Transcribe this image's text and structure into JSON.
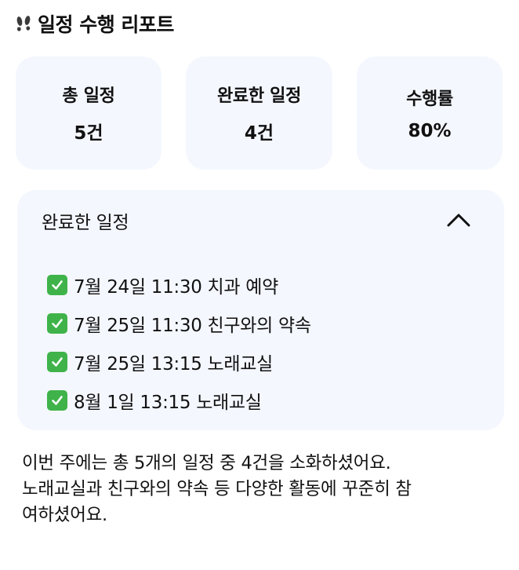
{
  "header": {
    "icon": "footprints-icon",
    "title": "일정 수행 리포트"
  },
  "stats": [
    {
      "label": "총 일정",
      "value": "5건"
    },
    {
      "label": "완료한 일정",
      "value": "4건"
    },
    {
      "label": "수행률",
      "value": "80%"
    }
  ],
  "completed": {
    "title": "완료한 일정",
    "expanded": true,
    "items": [
      {
        "text": "7월 24일 11:30 치과 예약"
      },
      {
        "text": "7월 25일 11:30 친구와의 약속"
      },
      {
        "text": "7월 25일 13:15 노래교실"
      },
      {
        "text": "8월 1일 13:15 노래교실"
      }
    ]
  },
  "summary": {
    "line1": "이번 주에는 총 5개의 일정 중 4건을 소화하셨어요.",
    "line2": "노래교실과 친구와의 약속 등 다양한 활동에 꾸준히 참",
    "line3": "여하셨어요."
  },
  "colors": {
    "card_background": "#f4f7fe",
    "check_green": "#3fb34a",
    "text": "#111111"
  }
}
